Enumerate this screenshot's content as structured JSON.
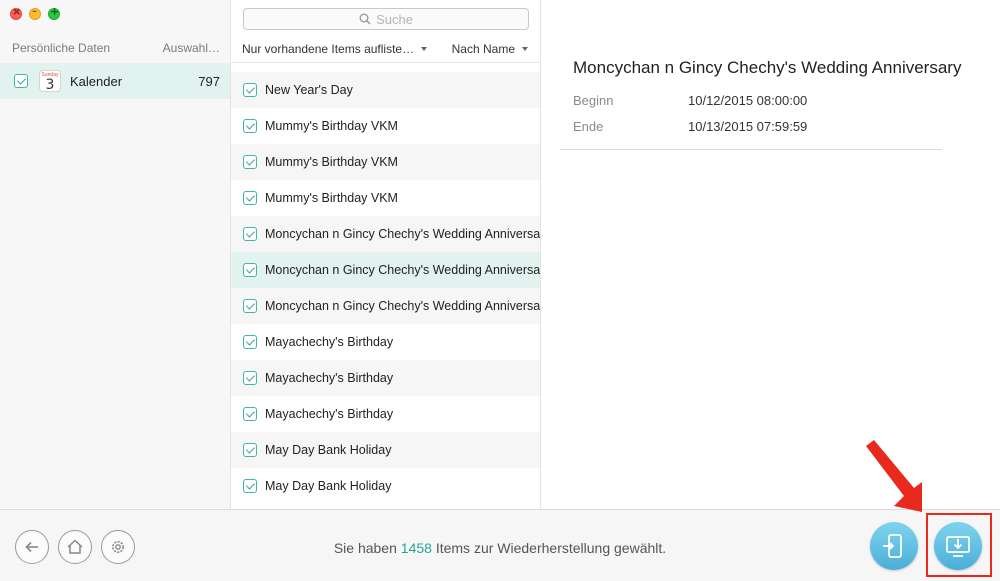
{
  "sidebar": {
    "header_left": "Persönliche Daten",
    "header_right": "Auswahl…",
    "items": [
      {
        "label": "Kalender",
        "count": "797",
        "icon_text": "Sunday",
        "icon_number": "3"
      }
    ]
  },
  "list": {
    "search_placeholder": "Suche",
    "filter_label": "Nur vorhandene Items aufliste…",
    "sort_label": "Nach Name",
    "items": [
      "New Year's Day",
      "Mummy's Birthday VKM",
      "Mummy's Birthday VKM",
      "Mummy's Birthday VKM",
      "Moncychan n Gincy Chechy's Wedding Anniversary",
      "Moncychan n Gincy Chechy's Wedding Anniversary",
      "Moncychan n Gincy Chechy's Wedding Anniversary",
      "Mayachechy's Birthday",
      "Mayachechy's Birthday",
      "Mayachechy's Birthday",
      "May Day Bank Holiday",
      "May Day Bank Holiday"
    ]
  },
  "detail": {
    "title": "Moncychan n Gincy Chechy's Wedding Anniversary",
    "begin_label": "Beginn",
    "begin_value": "10/12/2015 08:00:00",
    "end_label": "Ende",
    "end_value": "10/13/2015 07:59:59"
  },
  "footer": {
    "status_prefix": "Sie haben",
    "status_count": "1458",
    "status_suffix": "Items zur Wiederherstellung gewählt."
  },
  "colors": {
    "accent": "#2aa39a",
    "selection": "#e1f2ef",
    "annotation": "#e8291c"
  }
}
